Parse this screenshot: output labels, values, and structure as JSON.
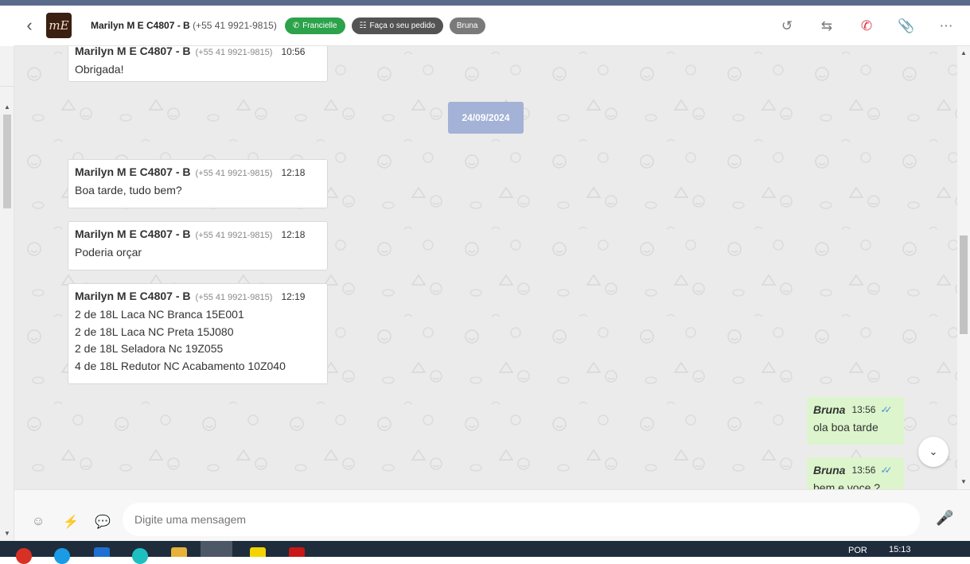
{
  "header": {
    "contact_name": "Marilyn M E C4807 - B",
    "contact_phone": "(+55 41 9921-9815)",
    "avatar_text": "mE",
    "badges": [
      "Francielle",
      "Faça o seu pedido",
      "Bruna"
    ]
  },
  "date_chip": "24/09/2024",
  "incoming": [
    {
      "name": "Marilyn M E C4807 - B",
      "phone": "(+55 41 9921-9815)",
      "time": "10:56",
      "lines": [
        "Obrigada!"
      ]
    },
    {
      "name": "Marilyn M E C4807 - B",
      "phone": "(+55 41 9921-9815)",
      "time": "12:18",
      "lines": [
        "Boa tarde, tudo bem?"
      ]
    },
    {
      "name": "Marilyn M E C4807 - B",
      "phone": "(+55 41 9921-9815)",
      "time": "12:18",
      "lines": [
        "Poderia orçar"
      ]
    },
    {
      "name": "Marilyn M E C4807 - B",
      "phone": "(+55 41 9921-9815)",
      "time": "12:19",
      "lines": [
        "2 de 18L Laca NC Branca 15E001",
        "2 de 18L Laca NC Preta 15J080",
        "2 de 18L Seladora Nc 19Z055",
        "4 de 18L Redutor NC Acabamento 10Z040"
      ]
    }
  ],
  "outgoing": [
    {
      "name": "Bruna",
      "time": "13:56",
      "text": "ola boa tarde"
    },
    {
      "name": "Bruna",
      "time": "13:56",
      "text": "bem e voce ?"
    }
  ],
  "composer": {
    "placeholder": "Digite uma mensagem"
  },
  "taskbar": {
    "language": "POR",
    "clock": "15:13"
  },
  "colors": {
    "badge_green": "#2ca24a",
    "date_chip": "#a3b2d6",
    "outgoing_bubble": "#dcf5cc",
    "chat_bg": "#ebebeb"
  }
}
